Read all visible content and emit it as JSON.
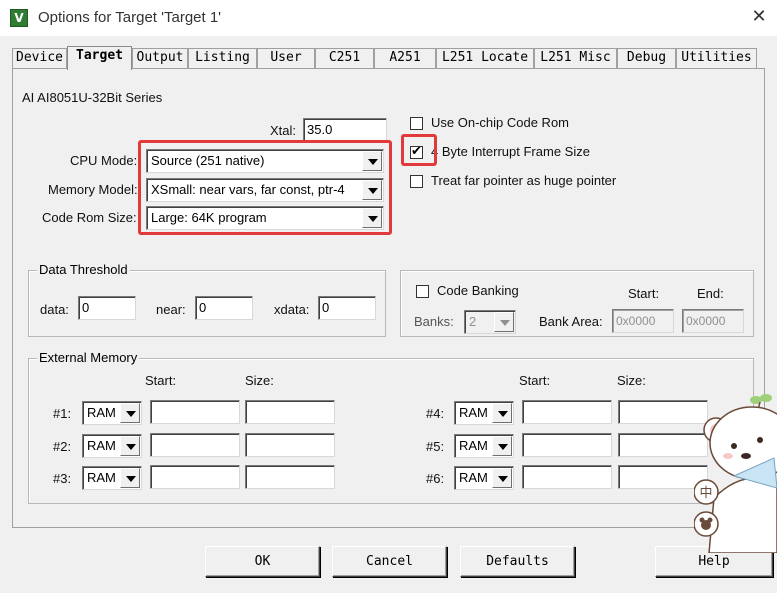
{
  "window": {
    "title": "Options for Target 'Target 1'"
  },
  "tabs": [
    "Device",
    "Target",
    "Output",
    "Listing",
    "User",
    "C251",
    "A251",
    "L251 Locate",
    "L251 Misc",
    "Debug",
    "Utilities"
  ],
  "target": {
    "device_name": "AI AI8051U-32Bit Series",
    "xtal_label": "Xtal:",
    "xtal_value": "35.0",
    "cpu_mode_label": "CPU Mode:",
    "cpu_mode_value": "Source (251 native)",
    "memory_model_label": "Memory Model:",
    "memory_model_value": "XSmall: near vars, far const, ptr-4",
    "code_rom_label": "Code Rom Size:",
    "code_rom_value": "Large: 64K program",
    "use_onchip_label": "Use On-chip Code Rom",
    "use_onchip_checked": false,
    "byte_interrupt_label": "4 Byte Interrupt Frame Size",
    "byte_interrupt_checked": true,
    "far_pointer_label": "Treat far pointer as huge pointer",
    "far_pointer_checked": false
  },
  "data_threshold": {
    "title": "Data Threshold",
    "data_label": "data:",
    "data_value": "0",
    "near_label": "near:",
    "near_value": "0",
    "xdata_label": "xdata:",
    "xdata_value": "0"
  },
  "code_banking": {
    "label": "Code Banking",
    "checked": false,
    "start_label": "Start:",
    "end_label": "End:",
    "banks_label": "Banks:",
    "banks_value": "2",
    "bank_area_label": "Bank Area:",
    "start_value": "0x0000",
    "end_value": "0x0000"
  },
  "external_memory": {
    "title": "External Memory",
    "start_header": "Start:",
    "size_header": "Size:",
    "rows": [
      {
        "label": "#1:",
        "type": "RAM"
      },
      {
        "label": "#2:",
        "type": "RAM"
      },
      {
        "label": "#3:",
        "type": "RAM"
      },
      {
        "label": "#4:",
        "type": "RAM"
      },
      {
        "label": "#5:",
        "type": "RAM"
      },
      {
        "label": "#6:",
        "type": "RAM"
      }
    ]
  },
  "buttons": {
    "ok": "OK",
    "cancel": "Cancel",
    "defaults": "Defaults",
    "help": "Help"
  },
  "colors": {
    "highlight_red": "#e03a3a",
    "dialog_bg": "#f0f0f0"
  }
}
